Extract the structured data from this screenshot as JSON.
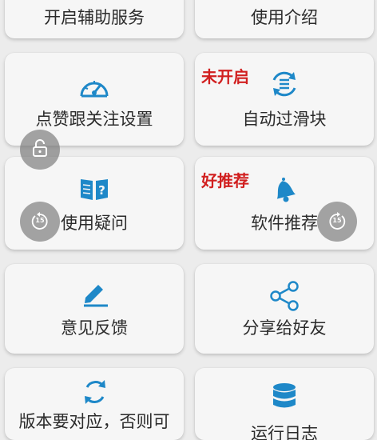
{
  "grid": {
    "row1": {
      "left_label": "开启辅助服务",
      "right_label": "使用介绍"
    },
    "row2": {
      "left_label": "点赞跟关注设置",
      "left_icon": "speedometer-icon",
      "right_label": "自动过滑块",
      "right_icon": "refresh-list-icon",
      "right_tag": "未开启"
    },
    "row3": {
      "left_label": "使用疑问",
      "left_icon": "book-question-icon",
      "right_label": "软件推荐",
      "right_icon": "bell-icon",
      "right_tag": "好推荐"
    },
    "row4": {
      "left_label": "意见反馈",
      "left_icon": "edit-pen-icon",
      "right_label": "分享给好友",
      "right_icon": "share-icon"
    },
    "row5": {
      "left_label": "版本要对应，否则可",
      "left_icon": "sync-icon",
      "right_label": "运行日志",
      "right_icon": "database-icon"
    }
  },
  "overlay": {
    "lock_icon": "lock-icon",
    "replay_left_text": "15",
    "replay_right_text": "15"
  },
  "colors": {
    "icon_blue": "#1e88c8",
    "tag_red": "#d11f1f"
  }
}
